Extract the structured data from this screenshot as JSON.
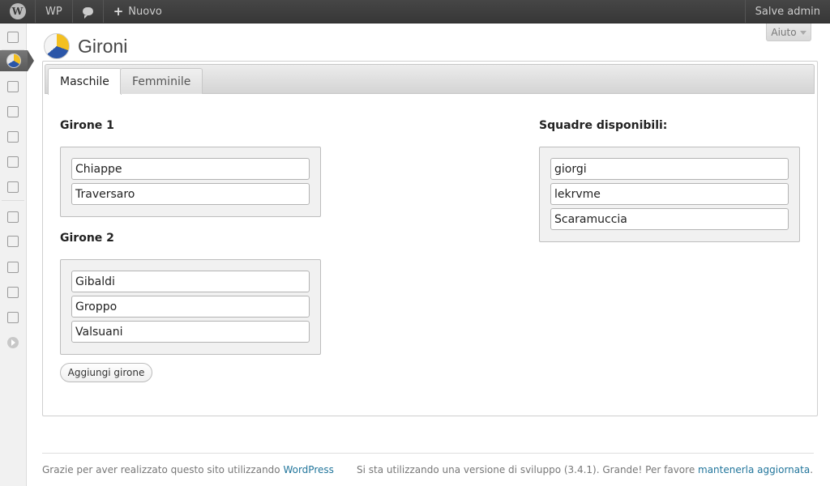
{
  "admin_bar": {
    "logo_glyph": "W",
    "site_name": "WP",
    "new_label": "Nuovo",
    "account_label": "Salve admin"
  },
  "help_tab": {
    "label": "Aiuto"
  },
  "page": {
    "title": "Gironi"
  },
  "tabs": [
    {
      "label": "Maschile",
      "active": true
    },
    {
      "label": "Femminile",
      "active": false
    }
  ],
  "groups": [
    {
      "title": "Girone 1",
      "teams": [
        "Chiappe",
        "Traversaro"
      ]
    },
    {
      "title": "Girone 2",
      "teams": [
        "Gibaldi",
        "Groppo",
        "Valsuani"
      ]
    }
  ],
  "available": {
    "title": "Squadre disponibili:",
    "teams": [
      "giorgi",
      "lekrvme",
      "Scaramuccia"
    ]
  },
  "add_group_label": "Aggiungi girone",
  "footer": {
    "left_text": "Grazie per aver realizzato questo sito utilizzando ",
    "left_link": "WordPress",
    "right_text": "Si sta utilizzando una versione di sviluppo (3.4.1). Grande! Per favore ",
    "right_link": "mantenerla aggiornata",
    "right_end": "."
  },
  "menu_icons": [
    "dashboard-icon",
    "tournament-icon",
    "posts-icon",
    "media-icon",
    "links-icon",
    "pages-icon",
    "comments-icon",
    "appearance-icon",
    "plugins-icon",
    "users-icon",
    "tools-icon",
    "settings-icon",
    "collapse-menu-icon"
  ],
  "colors": {
    "link": "#21759b",
    "admin_bar": "#464646"
  }
}
